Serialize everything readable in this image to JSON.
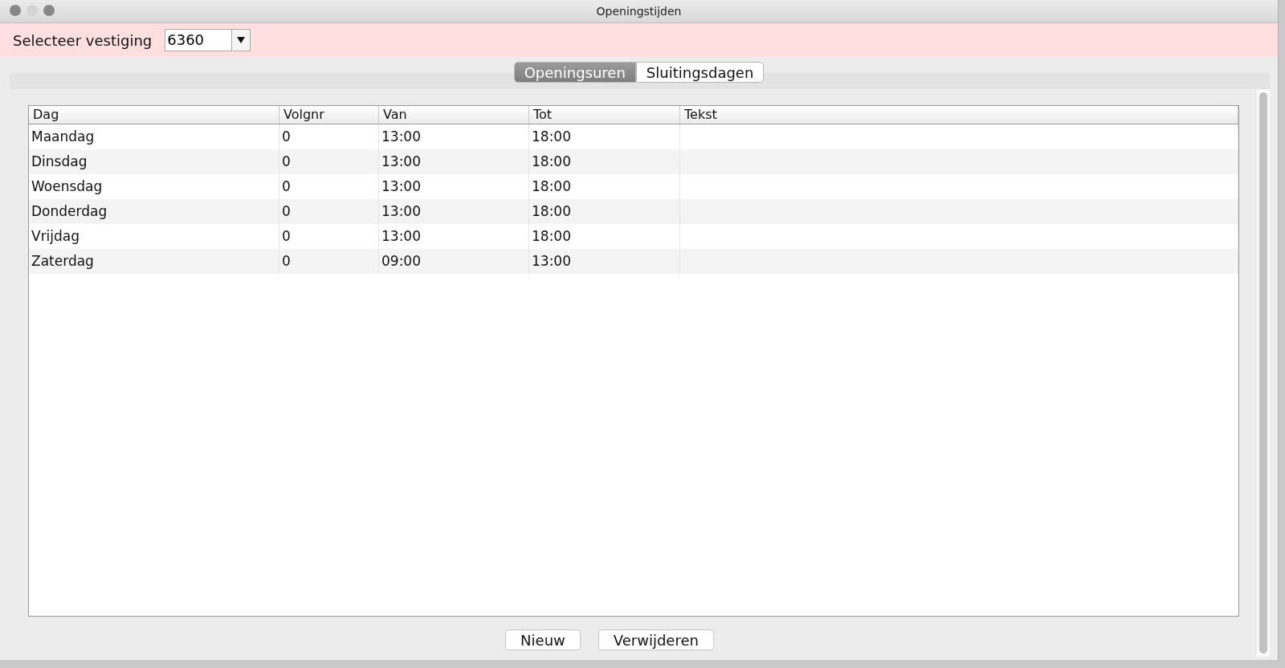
{
  "window": {
    "title": "Openingstijden"
  },
  "branch": {
    "label": "Selecteer vestiging",
    "value": "6360"
  },
  "tabs": [
    {
      "label": "Openingsuren",
      "selected": true
    },
    {
      "label": "Sluitingsdagen",
      "selected": false
    }
  ],
  "table": {
    "columns": [
      "Dag",
      "Volgnr",
      "Van",
      "Tot",
      "Tekst"
    ],
    "rows": [
      [
        "Maandag",
        "0",
        "13:00",
        "18:00",
        ""
      ],
      [
        "Dinsdag",
        "0",
        "13:00",
        "18:00",
        ""
      ],
      [
        "Woensdag",
        "0",
        "13:00",
        "18:00",
        ""
      ],
      [
        "Donderdag",
        "0",
        "13:00",
        "18:00",
        ""
      ],
      [
        "Vrijdag",
        "0",
        "13:00",
        "18:00",
        ""
      ],
      [
        "Zaterdag",
        "0",
        "09:00",
        "13:00",
        ""
      ]
    ]
  },
  "buttons": [
    "Nieuw",
    "Verwijderen"
  ]
}
